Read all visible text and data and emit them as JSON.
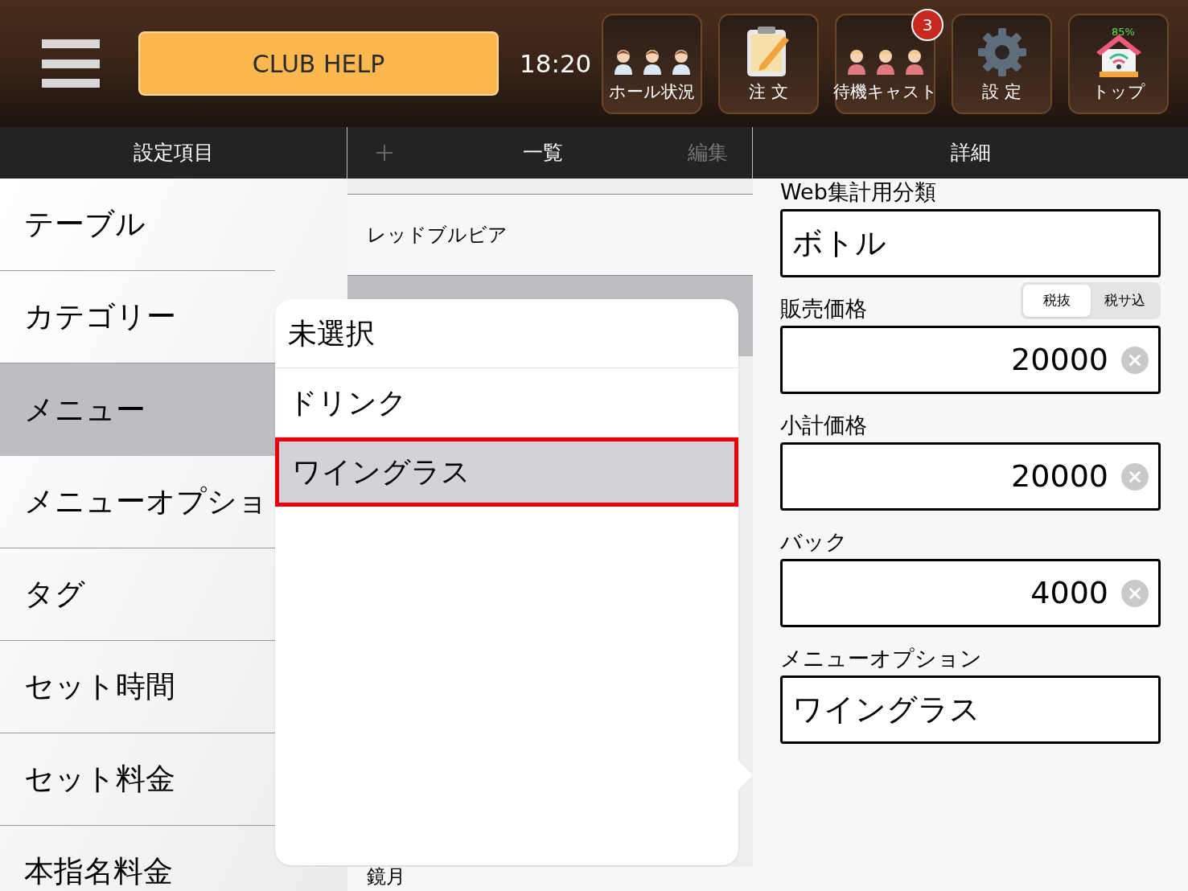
{
  "top_bar": {
    "help_button": "CLUB HELP",
    "time": "18:20",
    "tiles": [
      {
        "kind": "staff",
        "label": "ホール状況"
      },
      {
        "kind": "order",
        "label": "注 文"
      },
      {
        "kind": "cast",
        "label": "待機キャスト",
        "badge": "3"
      },
      {
        "kind": "settings",
        "label": "設 定"
      },
      {
        "kind": "home",
        "label": "トップ",
        "indicator": "85%"
      }
    ]
  },
  "column_headers": {
    "settings": "設定項目",
    "list": "一覧",
    "edit": "編集",
    "detail": "詳細"
  },
  "settings_items": [
    {
      "label": "テーブル",
      "selected": false
    },
    {
      "label": "カテゴリー",
      "selected": false
    },
    {
      "label": "メニュー",
      "selected": true
    },
    {
      "label": "メニューオプショ",
      "selected": false
    },
    {
      "label": "タグ",
      "selected": false
    },
    {
      "label": "セット時間",
      "selected": false
    },
    {
      "label": "セット料金",
      "selected": false
    },
    {
      "label": "本指名料金",
      "selected": false
    }
  ],
  "list_rows": [
    {
      "label": "レッドブルビア",
      "selected": false
    },
    {
      "selected": true
    },
    {
      "label": "鏡月",
      "selected": false
    }
  ],
  "popover_options": [
    {
      "label": "未選択",
      "selected": false
    },
    {
      "label": "ドリンク",
      "selected": false
    },
    {
      "label": "ワイングラス",
      "selected": true
    }
  ],
  "detail_fields": [
    {
      "kind": "text",
      "label": "Web集計用分類",
      "value": "ボトル"
    },
    {
      "kind": "number",
      "label": "販売価格",
      "value": "20000",
      "tax_toggle": [
        {
          "label": "税抜",
          "selected": true
        },
        {
          "label": "税サ込",
          "selected": false
        }
      ]
    },
    {
      "kind": "number",
      "label": "小計価格",
      "value": "20000"
    },
    {
      "kind": "number",
      "label": "バック",
      "value": "4000"
    },
    {
      "kind": "text",
      "label": "メニューオプション",
      "value": "ワイングラス"
    }
  ]
}
